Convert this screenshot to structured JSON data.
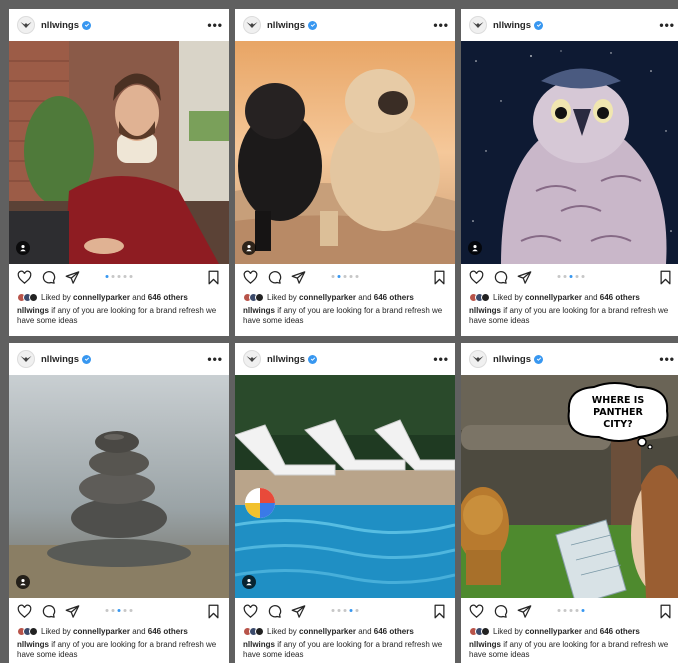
{
  "posts": [
    {
      "username": "nllwings",
      "liked_prefix": "Liked by",
      "liked_user": "connellyparker",
      "liked_and": "and",
      "liked_others": "646 others",
      "caption_user": "nllwings",
      "caption_text": "if any of you are looking for a brand refresh we have some ideas",
      "active_slide": 0
    },
    {
      "username": "nllwings",
      "liked_prefix": "Liked by",
      "liked_user": "connellyparker",
      "liked_and": "and",
      "liked_others": "646 others",
      "caption_user": "nllwings",
      "caption_text": "if any of you are looking for a brand refresh we have some ideas",
      "active_slide": 1
    },
    {
      "username": "nllwings",
      "liked_prefix": "Liked by",
      "liked_user": "connellyparker",
      "liked_and": "and",
      "liked_others": "646 others",
      "caption_user": "nllwings",
      "caption_text": "if any of you are looking for a brand refresh we have some ideas",
      "active_slide": 2
    },
    {
      "username": "nllwings",
      "liked_prefix": "Liked by",
      "liked_user": "connellyparker",
      "liked_and": "and",
      "liked_others": "646 others",
      "caption_user": "nllwings",
      "caption_text": "if any of you are looking for a brand refresh we have some ideas",
      "active_slide": 2
    },
    {
      "username": "nllwings",
      "liked_prefix": "Liked by",
      "liked_user": "connellyparker",
      "liked_and": "and",
      "liked_others": "646 others",
      "caption_user": "nllwings",
      "caption_text": "if any of you are looking for a brand refresh we have some ideas",
      "active_slide": 3
    },
    {
      "username": "nllwings",
      "liked_prefix": "Liked by",
      "liked_user": "connellyparker",
      "liked_and": "and",
      "liked_others": "646 others",
      "caption_user": "nllwings",
      "caption_text": "if any of you are looking for a brand refresh we have some ideas",
      "active_slide": 4,
      "speech_bubble": "WHERE IS PANTHER CITY?"
    }
  ],
  "icons": {
    "avatar": "wings-logo-icon",
    "verified": "verified-badge-icon",
    "more": "more-horizontal-icon",
    "like": "heart-icon",
    "comment": "comment-icon",
    "share": "send-icon",
    "save": "bookmark-icon",
    "tag": "user-tag-icon"
  },
  "colors": {
    "verified": "#3897f0",
    "active_dot": "#3897f0",
    "background": "#606060"
  }
}
